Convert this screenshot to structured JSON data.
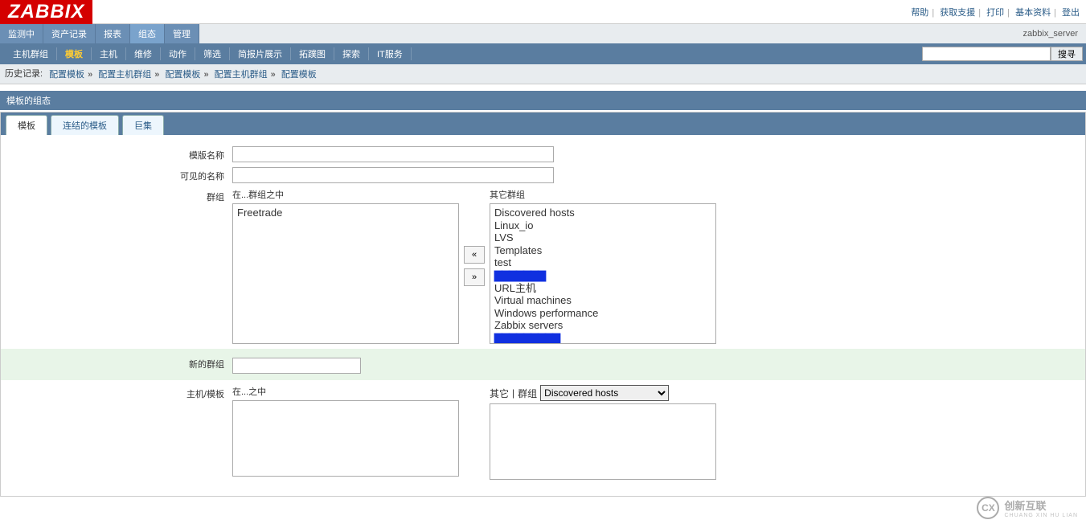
{
  "logo": "ZABBIX",
  "top_links": {
    "help": "帮助",
    "support": "获取支援",
    "print": "打印",
    "profile": "基本资料",
    "logout": "登出"
  },
  "nav1": {
    "monitoring": "监测中",
    "inventory": "资产记录",
    "reports": "报表",
    "configuration": "组态",
    "administration": "管理"
  },
  "server_name": "zabbix_server",
  "nav2": {
    "hostgroups": "主机群组",
    "templates": "模板",
    "hosts": "主机",
    "maintenance": "维修",
    "actions": "动作",
    "screens": "筛选",
    "slideshows": "简报片展示",
    "maps": "拓蹼图",
    "discovery": "探索",
    "itservices": "IT服务"
  },
  "search_button": "搜寻",
  "history": {
    "label": "历史记录:",
    "items": [
      "配置模板",
      "配置主机群组",
      "配置模板",
      "配置主机群组",
      "配置模板"
    ]
  },
  "section_title": "模板的组态",
  "tabs": {
    "template": "模板",
    "linked": "连结的模板",
    "macros": "巨集"
  },
  "form": {
    "template_name_label": "模版名称",
    "visible_name_label": "可见的名称",
    "groups_label": "群组",
    "in_groups_title": "在...群组之中",
    "other_groups_title": "其它群组",
    "in_groups_items": [
      "Freetrade"
    ],
    "other_groups_items": [
      "Discovered hosts",
      "Linux_io",
      "LVS",
      "Templates",
      "test",
      "(redacted)",
      "URL主机",
      "Virtual machines",
      "Windows performance",
      "Zabbix servers",
      "(redacted)"
    ],
    "move_left": "«",
    "move_right": "»",
    "new_group_label": "新的群组",
    "hosts_label": "主机/模板",
    "in_hosts_title": "在...之中",
    "other_hosts_title": "其它",
    "group_filter_label": "群组",
    "group_filter_selected": "Discovered hosts"
  },
  "watermark": {
    "logo": "CX",
    "text": "创新互联",
    "sub": "CHUANG XIN HU LIAN"
  }
}
